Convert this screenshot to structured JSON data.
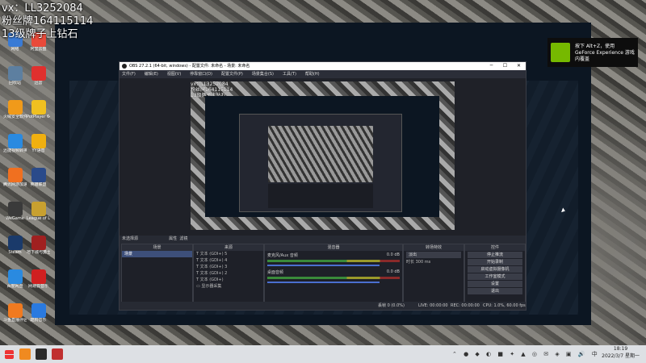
{
  "overlay": {
    "line1": "vx：LL3252084",
    "line2": "粉丝牌164115114",
    "line3": "13级牌子上钻石"
  },
  "desktop_icons": [
    {
      "label": "网络",
      "color": "#3a7bd5"
    },
    {
      "label": "阿里云盘",
      "color": "#e84a3a"
    },
    {
      "label": "回收站",
      "color": "#5d7fa0"
    },
    {
      "label": "迅雷",
      "color": "#e0302e"
    },
    {
      "label": "火绒安全软件",
      "color": "#f09a1a"
    },
    {
      "label": "PotPlayer 64",
      "color": "#f0c020"
    },
    {
      "label": "迅捷视频转换",
      "color": "#2a8ae0"
    },
    {
      "label": "YY语音",
      "color": "#f0b010"
    },
    {
      "label": "腾讯网游加速",
      "color": "#f07020"
    },
    {
      "label": "英雄联盟",
      "color": "#2a4a8a"
    },
    {
      "label": "WeGame",
      "color": "#3a3a3a"
    },
    {
      "label": "League of Legends",
      "color": "#c8a030"
    },
    {
      "label": "Steam",
      "color": "#1a3a6a"
    },
    {
      "label": "地下城与勇士",
      "color": "#a02020"
    },
    {
      "label": "百度网盘",
      "color": "#2a8ae0"
    },
    {
      "label": "网易云音乐",
      "color": "#d02020"
    },
    {
      "label": "斗鱼直播伴侣",
      "color": "#f07a20"
    },
    {
      "label": "酷狗音乐",
      "color": "#2a7ae0"
    }
  ],
  "nvidia": {
    "text": "按下 Alt+Z，使用 GeForce Experience 游戏内覆盖"
  },
  "obs": {
    "title": "OBS 27.2.1 (64-bit, windows) - 配置文件: 未命名 - 场景: 未命名",
    "menu": [
      "文件(F)",
      "编辑(E)",
      "视图(V)",
      "停靠窗口(D)",
      "配置文件(P)",
      "场景集合(S)",
      "工具(T)",
      "帮助(H)"
    ],
    "preview_overlay": [
      "vx：LL3252084",
      "粉丝牌164115114",
      "13级牌子上钻石"
    ],
    "tabs": [
      "未选择源",
      "属性",
      "滤镜"
    ],
    "docks": {
      "scenes": {
        "header": "场景",
        "items": [
          "场景"
        ]
      },
      "sources": {
        "header": "来源",
        "items": [
          "文本 (GDI+) 5",
          "文本 (GDI+) 4",
          "文本 (GDI+) 3",
          "文本 (GDI+) 2",
          "文本 (GDI+)",
          "显示器采集"
        ]
      },
      "mixer": {
        "header": "混音器",
        "channels": [
          {
            "name": "麦克风/Aux 音频",
            "db": "0.0 dB"
          },
          {
            "name": "桌面音频",
            "db": "0.0 dB"
          }
        ]
      },
      "transitions": {
        "header": "转场特效",
        "type": "淡出",
        "duration_label": "时长",
        "duration": "300 ms"
      },
      "controls": {
        "header": "控件",
        "buttons": [
          "停止推流",
          "开始录制",
          "启动虚拟摄像机",
          "工作室模式",
          "设置",
          "退出"
        ]
      }
    },
    "status": {
      "dropped": "丢帧 0 (0.0%)",
      "live": "LIVE: 00:00:00",
      "rec": "REC: 00:00:00",
      "cpu": "CPU: 1.0%, 60.00 fps"
    }
  },
  "taskbar": {
    "time": "18:19",
    "date": "2022/3/7 星期一",
    "lang": "中"
  }
}
